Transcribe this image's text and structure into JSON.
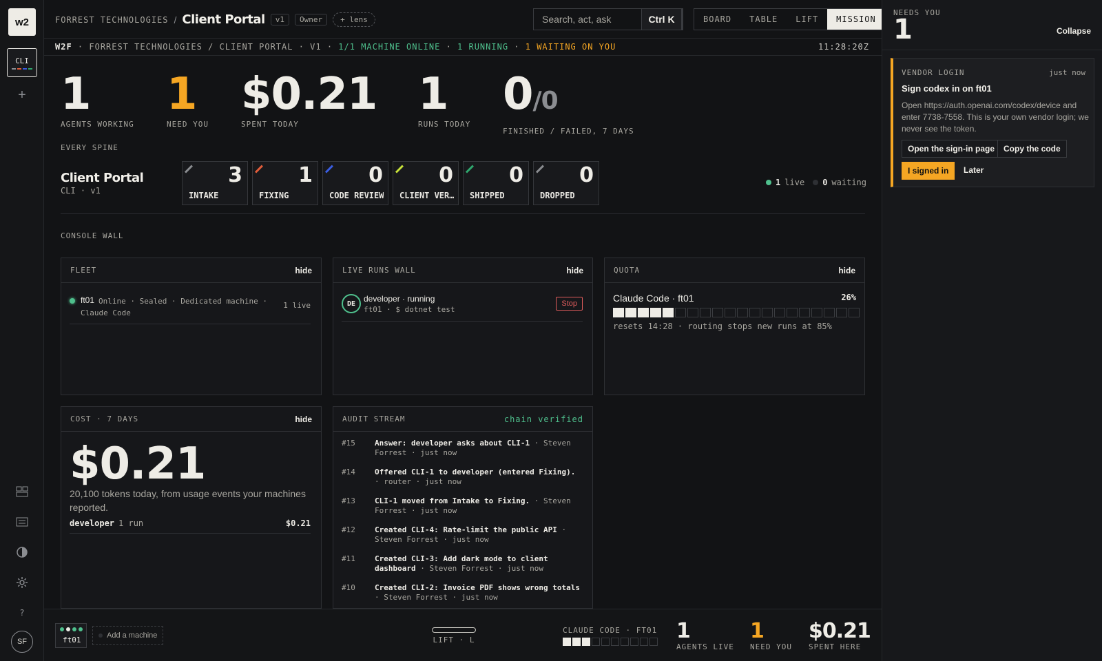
{
  "rail": {
    "logo": "w2",
    "workspace": "CLI",
    "avatar": "SF",
    "help": "?"
  },
  "header": {
    "org": "FORREST TECHNOLOGIES",
    "separator": "/",
    "project": "Client Portal",
    "version": "v1",
    "role": "Owner",
    "lens": "+ lens",
    "search_placeholder": "Search, act, ask",
    "shortcut": "Ctrl K",
    "views": [
      "BOARD",
      "TABLE",
      "LIFT",
      "MISSION"
    ],
    "active_view": "MISSION"
  },
  "status": {
    "brand": "W2F",
    "path": "FORREST TECHNOLOGIES / CLIENT PORTAL",
    "version": "V1",
    "machines": "1/1 MACHINE ONLINE",
    "running": "1 RUNNING",
    "waiting": "1 WAITING ON YOU",
    "clock": "11:28:20Z"
  },
  "stats": {
    "agents_working": {
      "value": "1",
      "label": "AGENTS WORKING"
    },
    "need_you": {
      "value": "1",
      "label": "NEED YOU"
    },
    "spent_today": {
      "value": "$0.21",
      "label": "SPENT TODAY"
    },
    "runs_today": {
      "value": "1",
      "label": "RUNS TODAY"
    },
    "finished": {
      "value": "0",
      "failed": "/0",
      "label": "FINISHED / FAILED, 7 DAYS"
    }
  },
  "spine": {
    "section": "EVERY SPINE",
    "title": "Client Portal",
    "subtitle": "CLI · v1",
    "stages": [
      {
        "name": "INTAKE",
        "count": "3",
        "color": "#8b8d91"
      },
      {
        "name": "FIXING",
        "count": "1",
        "color": "#e25d3a"
      },
      {
        "name": "CODE REVIEW",
        "count": "0",
        "color": "#3a5de2"
      },
      {
        "name": "CLIENT VER…",
        "count": "0",
        "color": "#c8e23a"
      },
      {
        "name": "SHIPPED",
        "count": "0",
        "color": "#2fa86e"
      },
      {
        "name": "DROPPED",
        "count": "0",
        "color": "#8b8d91"
      }
    ],
    "live_count": "1",
    "live_label": "live",
    "waiting_count": "0",
    "waiting_label": "waiting"
  },
  "console": {
    "section": "CONSOLE WALL",
    "hide": "hide",
    "fleet": {
      "title": "FLEET",
      "machine": "ft01",
      "meta": "Online · Sealed · Dedicated machine · Claude Code",
      "live": "1 live"
    },
    "runs": {
      "title": "LIVE RUNS WALL",
      "avatar": "DE",
      "name": "developer · running",
      "sub": "ft01 · $ dotnet test",
      "stop": "Stop"
    },
    "quota": {
      "title": "QUOTA",
      "name": "Claude Code · ft01",
      "percent": "26%",
      "percent_value": 0.26,
      "note": "resets 14:28 · routing stops new runs at 85%"
    },
    "cost": {
      "title": "COST · 7 DAYS",
      "value": "$0.21",
      "note": "20,100 tokens today, from usage events your machines reported.",
      "row_name": "developer",
      "row_runs": "1 run",
      "row_value": "$0.21"
    },
    "audit": {
      "title": "AUDIT STREAM",
      "verified": "chain verified",
      "items": [
        {
          "id": "#15",
          "text": "Answer: developer asks about CLI-1",
          "meta": " · Steven Forrest · just now"
        },
        {
          "id": "#14",
          "text": "Offered CLI-1 to developer (entered Fixing).",
          "meta": " · router · just now"
        },
        {
          "id": "#13",
          "text": "CLI-1 moved from Intake to Fixing.",
          "meta": " · Steven Forrest · just now"
        },
        {
          "id": "#12",
          "text": "Created CLI-4: Rate-limit the public API",
          "meta": " · Steven Forrest · just now"
        },
        {
          "id": "#11",
          "text": "Created CLI-3: Add dark mode to client dashboard",
          "meta": " · Steven Forrest · just now"
        },
        {
          "id": "#10",
          "text": "Created CLI-2: Invoice PDF shows wrong totals",
          "meta": " · Steven Forrest · just now"
        }
      ]
    }
  },
  "bottom": {
    "machine": "ft01",
    "add_machine": "Add a machine",
    "lift": "LIFT · L",
    "quota_label": "CLAUDE CODE · FT01",
    "quota_value": 0.26,
    "agents_live": {
      "value": "1",
      "label": "AGENTS LIVE"
    },
    "need_you": {
      "value": "1",
      "label": "NEED YOU"
    },
    "spent_here": {
      "value": "$0.21",
      "label": "SPENT HERE"
    }
  },
  "right": {
    "needs_label": "NEEDS YOU",
    "needs_count": "1",
    "collapse": "Collapse",
    "card": {
      "kind": "VENDOR LOGIN",
      "when": "just now",
      "title": "Sign codex in on ft01",
      "body": "Open https://auth.openai.com/codex/device and enter 7738-7558. This is your own vendor login; we never see the token.",
      "open_btn": "Open the sign-in page",
      "copy_btn": "Copy the code",
      "signed_btn": "I signed in",
      "later_btn": "Later"
    }
  },
  "colors": {
    "accent_orange": "#f5a623",
    "live_green": "#4fc08d",
    "stop_red": "#e25d5d"
  }
}
